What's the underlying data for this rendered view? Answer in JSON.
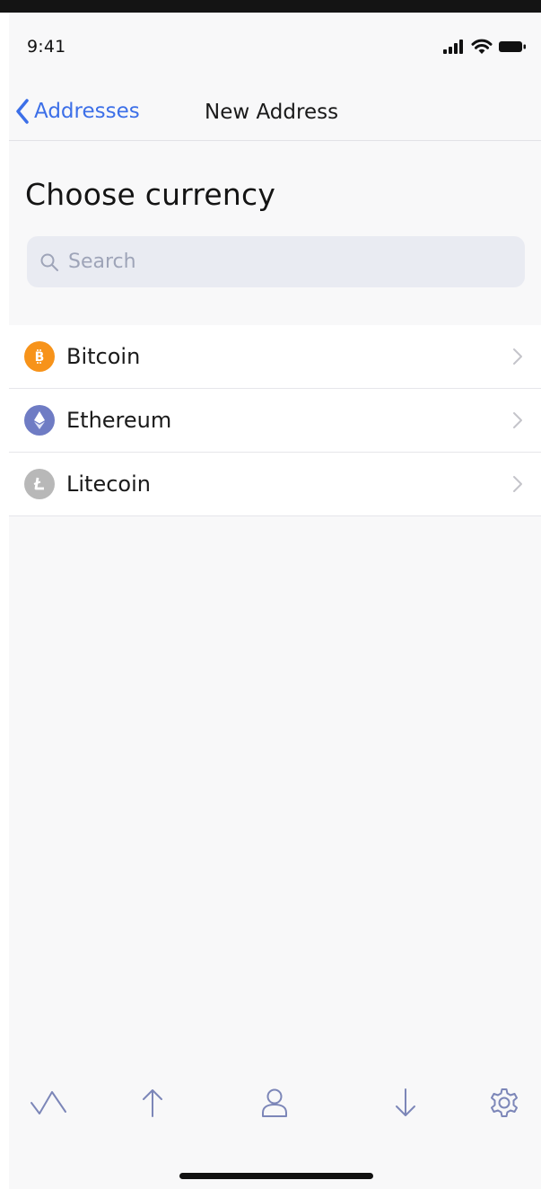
{
  "status_bar": {
    "time": "9:41",
    "icons": [
      "cellular-signal-icon",
      "wifi-icon",
      "battery-icon"
    ]
  },
  "nav": {
    "back_label": "Addresses",
    "title": "New Address"
  },
  "page": {
    "title": "Choose currency"
  },
  "search": {
    "placeholder": "Search",
    "value": ""
  },
  "currencies": [
    {
      "label": "Bitcoin",
      "icon": "bitcoin-icon",
      "color": "#f7931a"
    },
    {
      "label": "Ethereum",
      "icon": "ethereum-icon",
      "color": "#6f7cc4"
    },
    {
      "label": "Litecoin",
      "icon": "litecoin-icon",
      "color": "#b8b8b8"
    }
  ],
  "tab_bar": {
    "items": [
      "activity-icon",
      "send-icon",
      "contacts-icon",
      "receive-icon",
      "settings-icon"
    ]
  },
  "colors": {
    "accent": "#3c6fe8",
    "tab_icon": "#7c86b8",
    "background": "#f8f8f9"
  }
}
